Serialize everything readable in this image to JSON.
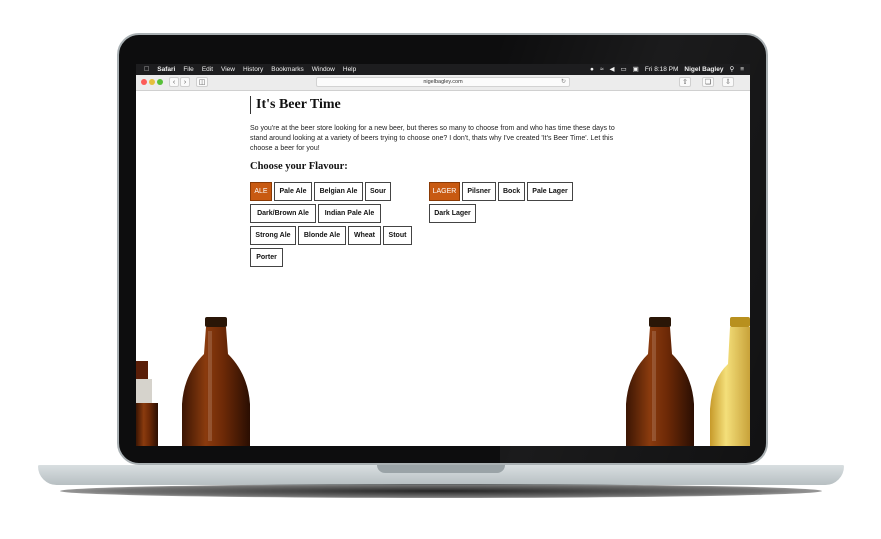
{
  "menubar": {
    "app": "Safari",
    "items": [
      "File",
      "Edit",
      "View",
      "History",
      "Bookmarks",
      "Window",
      "Help"
    ],
    "clock": "Fri 8:18 PM",
    "user": "Nigel Bagley"
  },
  "browser": {
    "url": "nigelbagley.com"
  },
  "page": {
    "title": "It's Beer Time",
    "intro": "So you're at the beer store looking for a new beer, but theres so many to choose from and who has time these days to stand around looking at a variety of beers trying to choose one? I don't, thats why I've created 'It's Beer Time'. Let this choose a beer for you!",
    "flavour_heading": "Choose your Flavour:"
  },
  "ale_buttons": [
    "ALE",
    "Pale Ale",
    "Belgian Ale",
    "Sour",
    "Dark/Brown Ale",
    "Indian Pale Ale",
    "Strong Ale",
    "Blonde Ale",
    "Wheat",
    "Stout",
    "Porter"
  ],
  "lager_buttons": [
    "LAGER",
    "Pilsner",
    "Bock",
    "Pale Lager",
    "Dark Lager"
  ],
  "colors": {
    "active_button": "#c85a12",
    "menubar": "#1d1d1f"
  },
  "icons": [
    "apple-icon",
    "time-machine-icon",
    "wifi-icon",
    "volume-icon",
    "battery-icon",
    "display-icon",
    "search-icon",
    "list-icon",
    "back-icon",
    "forward-icon",
    "sidebar-icon",
    "share-icon",
    "tabs-icon",
    "download-icon",
    "reload-icon"
  ]
}
